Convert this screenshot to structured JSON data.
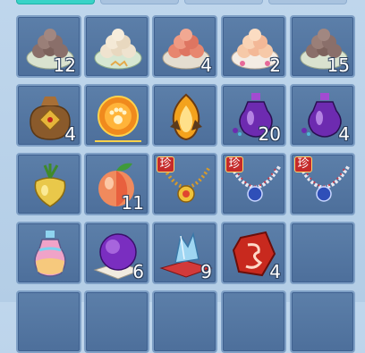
{
  "inventory": {
    "rows": [
      [
        {
          "item": "dark-rice-balls-plate-icon",
          "count": "12"
        },
        {
          "item": "pale-rice-balls-plate-icon",
          "count": ""
        },
        {
          "item": "red-rice-balls-plate-icon",
          "count": "4"
        },
        {
          "item": "pink-rice-balls-plate-icon",
          "count": "2"
        },
        {
          "item": "dark-rice-balls-plate-icon",
          "count": "15"
        }
      ],
      [
        {
          "item": "treasure-pouch-icon",
          "count": "4"
        },
        {
          "item": "paw-print-orb-icon",
          "count": ""
        },
        {
          "item": "flame-crystal-icon",
          "count": ""
        },
        {
          "item": "purple-potion-bottle-icon",
          "count": "20"
        },
        {
          "item": "purple-potion-bottle-icon",
          "count": "4"
        }
      ],
      [
        {
          "item": "golden-radish-icon",
          "count": ""
        },
        {
          "item": "peach-icon",
          "count": "11"
        },
        {
          "item": "gold-bead-necklace-icon",
          "count": "",
          "badge": "珍"
        },
        {
          "item": "blue-gem-necklace-icon",
          "count": "",
          "badge": "珍"
        },
        {
          "item": "blue-gem-necklace-icon",
          "count": "",
          "badge": "珍"
        }
      ],
      [
        {
          "item": "rainbow-potion-bottle-icon",
          "count": ""
        },
        {
          "item": "purple-crystal-ball-icon",
          "count": "6"
        },
        {
          "item": "blue-crystal-on-cushion-icon",
          "count": "9"
        },
        {
          "item": "red-rune-stone-icon",
          "count": "4"
        },
        {
          "item": "empty-slot",
          "count": ""
        }
      ]
    ]
  }
}
